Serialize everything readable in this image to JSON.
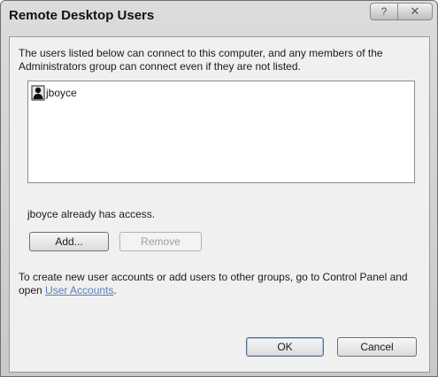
{
  "window": {
    "title": "Remote Desktop Users",
    "help_glyph": "?",
    "close_glyph": "✕"
  },
  "description": "The users listed below can connect to this computer, and any members of the Administrators group can connect even if they are not listed.",
  "users": [
    {
      "name": "jboyce",
      "icon": "user-icon"
    }
  ],
  "status": "jboyce already has access.",
  "buttons": {
    "add": "Add...",
    "remove": "Remove",
    "ok": "OK",
    "cancel": "Cancel"
  },
  "footer": {
    "text_before": "To create new user accounts or add users to other groups, go to Control Panel and open ",
    "link": "User Accounts",
    "text_after": "."
  }
}
